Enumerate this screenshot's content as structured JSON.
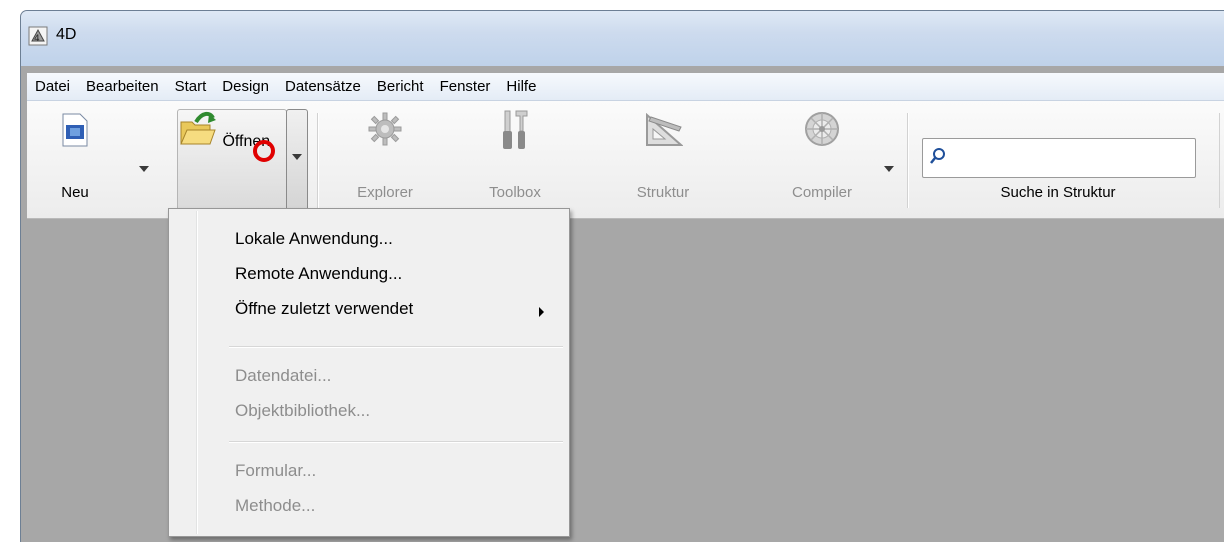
{
  "window": {
    "title": "4D"
  },
  "menubar": {
    "items": [
      "Datei",
      "Bearbeiten",
      "Start",
      "Design",
      "Datensätze",
      "Bericht",
      "Fenster",
      "Hilfe"
    ]
  },
  "toolbar": {
    "new_label": "Neu",
    "open_label": "Öffnen",
    "explorer_label": "Explorer",
    "toolbox_label": "Toolbox",
    "structure_label": "Struktur",
    "compiler_label": "Compiler",
    "search_label": "Suche in Struktur",
    "search_value": "",
    "disabled_tools": [
      "Explorer",
      "Toolbox",
      "Struktur",
      "Compiler"
    ]
  },
  "open_menu": {
    "items": [
      {
        "label": "Lokale Anwendung...",
        "enabled": true
      },
      {
        "label": "Remote Anwendung...",
        "enabled": true
      },
      {
        "label": "Öffne zuletzt verwendet",
        "enabled": true,
        "submenu": true
      },
      {
        "label": "Datendatei...",
        "enabled": false
      },
      {
        "label": "Objektbibliothek...",
        "enabled": false
      },
      {
        "label": "Formular...",
        "enabled": false
      },
      {
        "label": "Methode...",
        "enabled": false
      }
    ]
  },
  "colors": {
    "highlight_ring": "#e00000",
    "workspace_bg": "#a7a7a7",
    "titlebar": "#cddbee"
  }
}
